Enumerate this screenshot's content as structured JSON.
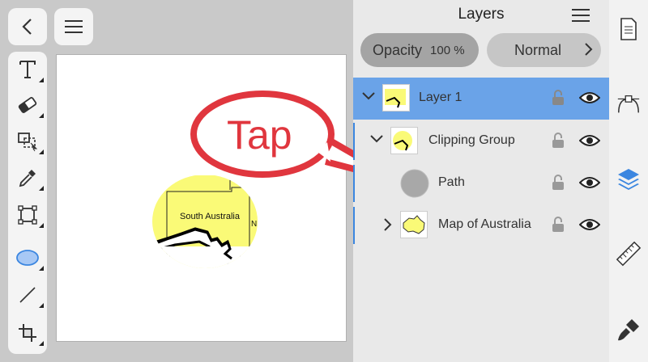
{
  "nav": {
    "back_icon": "chevron-left-icon",
    "menu_icon": "hamburger-menu-icon"
  },
  "tools": [
    "text-tool-icon",
    "eraser-icon",
    "selection-icon",
    "eyedropper-icon",
    "crop-icon",
    "ellipse-tool-icon",
    "line-tool-icon",
    "page-icon"
  ],
  "canvas": {
    "map_label": "South Australia",
    "map_edge_label": "N"
  },
  "callout": {
    "text": "Tap",
    "color": "#e0363e"
  },
  "layers_panel": {
    "title": "Layers",
    "opacity_label": "Opacity",
    "opacity_value": "100 %",
    "blend_mode": "Normal",
    "layers": [
      {
        "name": "Layer 1",
        "selected": true
      },
      {
        "name": "Clipping Group",
        "selected": false
      },
      {
        "name": "Path",
        "selected": false
      },
      {
        "name": "Map of Australia",
        "selected": false
      }
    ]
  },
  "right_rail": [
    "document-icon",
    "node-tool-icon",
    "layers-icon",
    "ruler-icon",
    "brush-icon"
  ],
  "colors": {
    "accent": "#3b86e0",
    "selected_row": "#6aa3e8",
    "shape_fill": "#fafa77"
  }
}
